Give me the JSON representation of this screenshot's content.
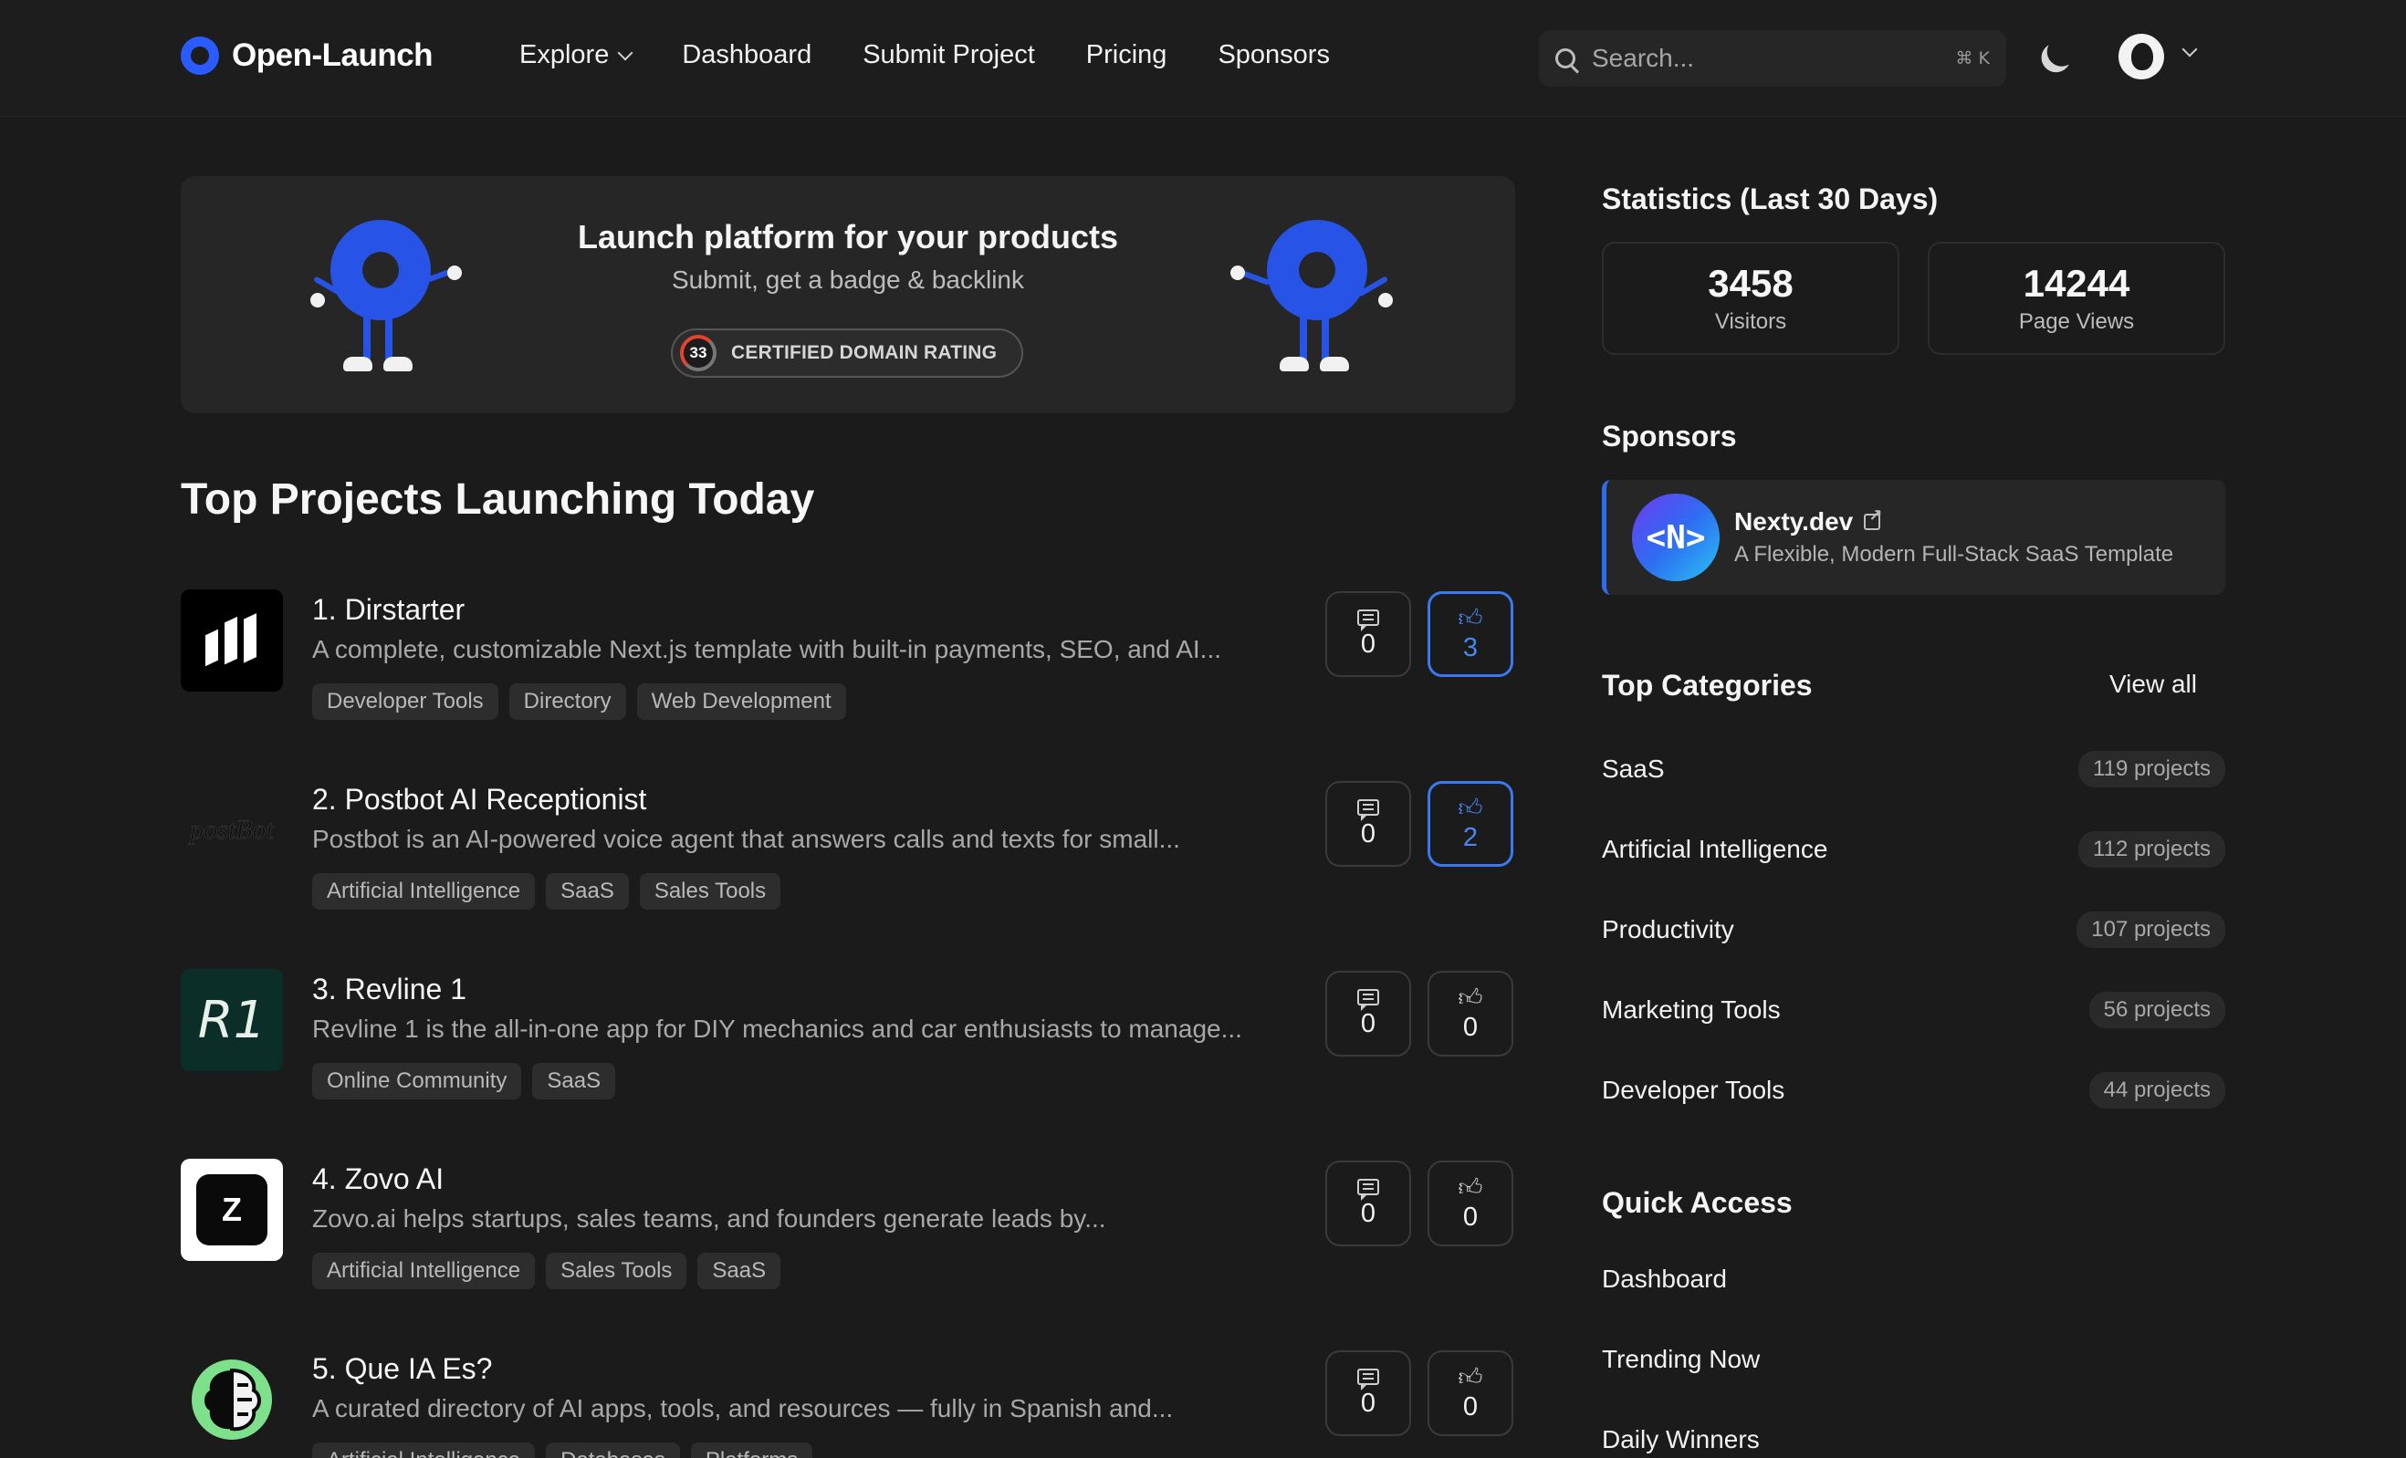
{
  "header": {
    "brand": "Open-Launch",
    "nav": [
      {
        "label": "Explore",
        "has_dropdown": true
      },
      {
        "label": "Dashboard"
      },
      {
        "label": "Submit Project"
      },
      {
        "label": "Pricing"
      },
      {
        "label": "Sponsors"
      }
    ],
    "search": {
      "placeholder": "Search...",
      "shortcut": "⌘ K"
    }
  },
  "hero": {
    "title": "Launch platform for your products",
    "subtitle": "Submit, get a badge & backlink",
    "badge": {
      "rating": "33",
      "label": "CERTIFIED DOMAIN RATING"
    }
  },
  "projects_section": {
    "title": "Top Projects Launching Today",
    "items": [
      {
        "name": "1. Dirstarter",
        "description": "A complete, customizable Next.js template with built-in payments, SEO, and AI...",
        "tags": [
          "Developer Tools",
          "Directory",
          "Web Development"
        ],
        "comments": "0",
        "upvotes": "3",
        "upvoted": true,
        "logo": "dirstarter-logo"
      },
      {
        "name": "2. Postbot AI Receptionist",
        "description": "Postbot is an AI-powered voice agent that answers calls and texts for small...",
        "tags": [
          "Artificial Intelligence",
          "SaaS",
          "Sales Tools"
        ],
        "comments": "0",
        "upvotes": "2",
        "upvoted": true,
        "logo": "postbot-logo",
        "logo_text": "postBot"
      },
      {
        "name": "3. Revline 1",
        "description": "Revline 1 is the all-in-one app for DIY mechanics and car enthusiasts to manage...",
        "tags": [
          "Online Community",
          "SaaS"
        ],
        "comments": "0",
        "upvotes": "0",
        "upvoted": false,
        "logo": "revline-logo",
        "logo_text": "R1"
      },
      {
        "name": "4. Zovo AI",
        "description": "Zovo.ai helps startups, sales teams, and founders generate leads by...",
        "tags": [
          "Artificial Intelligence",
          "Sales Tools",
          "SaaS"
        ],
        "comments": "0",
        "upvotes": "0",
        "upvoted": false,
        "logo": "zovo-logo",
        "logo_text": "Z"
      },
      {
        "name": "5. Que IA Es?",
        "description": "A curated directory of AI apps, tools, and resources — fully in Spanish and...",
        "tags": [
          "Artificial Intelligence",
          "Databases",
          "Platforms"
        ],
        "comments": "0",
        "upvotes": "0",
        "upvoted": false,
        "logo": "queiaes-logo"
      }
    ]
  },
  "sidebar": {
    "stats_title": "Statistics (Last 30 Days)",
    "stats": [
      {
        "value": "3458",
        "label": "Visitors"
      },
      {
        "value": "14244",
        "label": "Page Views"
      }
    ],
    "sponsors_title": "Sponsors",
    "sponsor": {
      "logo_text": "<N>",
      "name": "Nexty.dev",
      "description": "A Flexible, Modern Full-Stack SaaS Template"
    },
    "categories_title": "Top Categories",
    "view_all": "View all",
    "categories": [
      {
        "name": "SaaS",
        "count": "119 projects"
      },
      {
        "name": "Artificial Intelligence",
        "count": "112 projects"
      },
      {
        "name": "Productivity",
        "count": "107 projects"
      },
      {
        "name": "Marketing Tools",
        "count": "56 projects"
      },
      {
        "name": "Developer Tools",
        "count": "44 projects"
      }
    ],
    "quick_access_title": "Quick Access",
    "quick_access": [
      "Dashboard",
      "Trending Now",
      "Daily Winners"
    ]
  },
  "colors": {
    "background": "#1b1b1b",
    "accent": "#3c78f0",
    "brand": "#2a5bff"
  }
}
